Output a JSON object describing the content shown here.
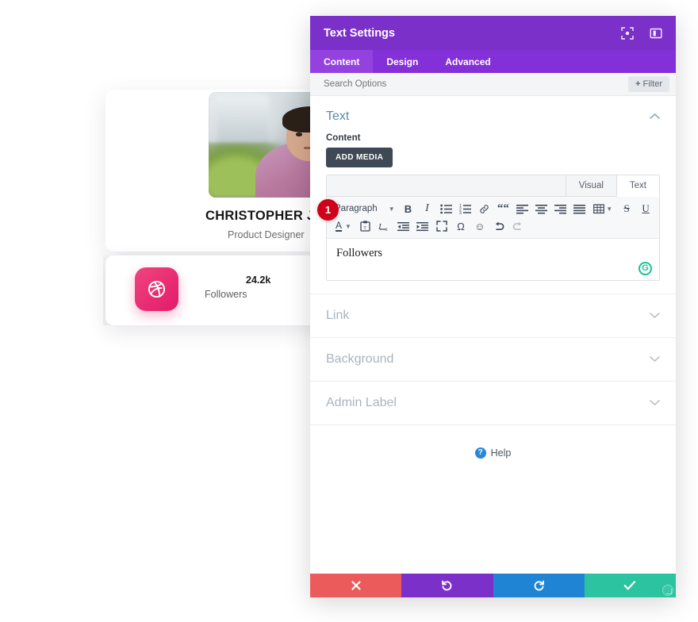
{
  "preview": {
    "profile": {
      "name": "CHRISTOPHER JOE",
      "role": "Product Designer",
      "photo_alt": "profile-photo"
    },
    "stat": {
      "value": "24.2k",
      "label": "Followers",
      "icon": "dribbble-icon",
      "icon_color": "#e21b69"
    }
  },
  "modal": {
    "title": "Text Settings",
    "header_icons": [
      {
        "name": "expand-icon"
      },
      {
        "name": "layout-panel-icon"
      }
    ],
    "tabs": [
      {
        "label": "Content",
        "active": true
      },
      {
        "label": "Design",
        "active": false
      },
      {
        "label": "Advanced",
        "active": false
      }
    ],
    "search": {
      "placeholder": "Search Options",
      "value": ""
    },
    "filter_button": {
      "plus": "+",
      "label": "Filter"
    },
    "section": {
      "title": "Text",
      "chevron": "chevron-up-icon",
      "field_label": "Content",
      "add_media_label": "ADD MEDIA"
    },
    "editor": {
      "tabs": [
        {
          "label": "Visual",
          "active": false
        },
        {
          "label": "Text",
          "active": true
        }
      ],
      "format_select": "Paragraph",
      "toolbar_row1": [
        {
          "name": "bold-icon",
          "glyph": "B"
        },
        {
          "name": "italic-icon",
          "glyph": "I"
        },
        {
          "name": "bullet-list-icon",
          "glyph": ""
        },
        {
          "name": "numbered-list-icon",
          "glyph": ""
        },
        {
          "name": "link-icon",
          "glyph": ""
        },
        {
          "name": "blockquote-icon",
          "glyph": "“"
        },
        {
          "name": "align-left-icon",
          "glyph": ""
        },
        {
          "name": "align-center-icon",
          "glyph": ""
        },
        {
          "name": "align-right-icon",
          "glyph": ""
        },
        {
          "name": "align-justify-icon",
          "glyph": ""
        },
        {
          "name": "table-icon",
          "glyph": ""
        },
        {
          "name": "strikethrough-icon",
          "glyph": "S"
        },
        {
          "name": "underline-icon",
          "glyph": "U"
        }
      ],
      "toolbar_row2": [
        {
          "name": "text-color-icon",
          "glyph": "A"
        },
        {
          "name": "paste-as-text-icon",
          "glyph": ""
        },
        {
          "name": "clear-formatting-icon",
          "glyph": ""
        },
        {
          "name": "outdent-icon",
          "glyph": ""
        },
        {
          "name": "indent-icon",
          "glyph": ""
        },
        {
          "name": "fullscreen-icon",
          "glyph": ""
        },
        {
          "name": "special-character-icon",
          "glyph": "Ω"
        },
        {
          "name": "emoji-icon",
          "glyph": "☺"
        },
        {
          "name": "undo-icon",
          "glyph": ""
        },
        {
          "name": "redo-icon",
          "glyph": ""
        }
      ],
      "content_value": "Followers",
      "grammarly_badge": "G"
    },
    "badge": "1",
    "accordion": [
      {
        "label": "Link",
        "chevron": "chevron-down-icon"
      },
      {
        "label": "Background",
        "chevron": "chevron-down-icon"
      },
      {
        "label": "Admin Label",
        "chevron": "chevron-down-icon"
      }
    ],
    "help": {
      "icon_glyph": "?",
      "label": "Help"
    },
    "footer": [
      {
        "name": "cancel-button",
        "icon": "close-icon",
        "color": "#eb5b5b"
      },
      {
        "name": "undo-button",
        "icon": "undo-icon",
        "color": "#7b30ca"
      },
      {
        "name": "redo-button",
        "icon": "redo-icon",
        "color": "#2084d4"
      },
      {
        "name": "save-button",
        "icon": "check-icon",
        "color": "#2cc4a0"
      }
    ]
  }
}
